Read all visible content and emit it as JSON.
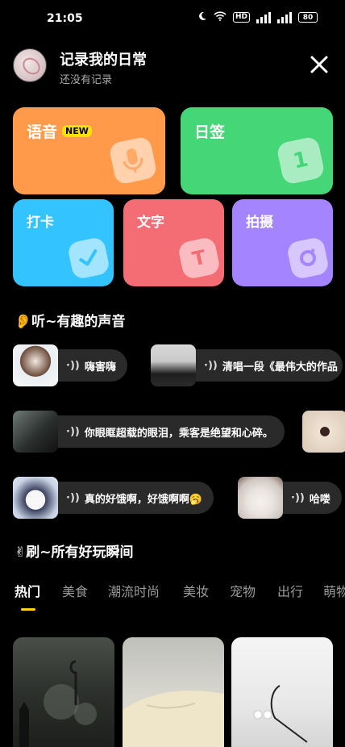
{
  "status": {
    "time": "21:05",
    "network": "HD",
    "battery": "80"
  },
  "header": {
    "title": "记录我的日常",
    "subtitle": "还没有记录"
  },
  "cards": {
    "voice": {
      "label": "语音",
      "badge": "NEW",
      "color": "#ff9a4a"
    },
    "sign": {
      "label": "日签",
      "icon_text": "1",
      "color": "#44d677"
    },
    "punch": {
      "label": "打卡",
      "color": "#33c4ff"
    },
    "text": {
      "label": "文字",
      "icon_text": "T",
      "color": "#f46c74"
    },
    "shoot": {
      "label": "拍摄",
      "color": "#a585ff"
    }
  },
  "listen_section": {
    "title": "👂听~有趣的声音"
  },
  "sounds": [
    {
      "text": "嗨害嗨"
    },
    {
      "text": "清唱一段《最伟大的作品"
    },
    {
      "text": "你眼眶超载的眼泪，乘客是绝望和心碎。"
    },
    {
      "text": "真的好饿啊，好饿啊啊🥱"
    },
    {
      "text": "哈喽"
    }
  ],
  "browse_section": {
    "title": "✌刷~所有好玩瞬间"
  },
  "tabs": [
    "热门",
    "美食",
    "潮流时尚",
    "美妆",
    "宠物",
    "出行",
    "萌物"
  ],
  "accent_color": "#ffd21e"
}
